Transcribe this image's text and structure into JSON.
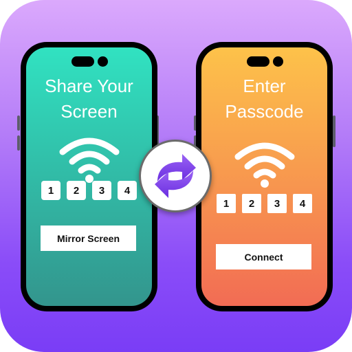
{
  "left_phone": {
    "title_line1": "Share Your",
    "title_line2": "Screen",
    "wifi_icon": "wifi-icon",
    "passcode_digits": [
      "1",
      "2",
      "3",
      "4"
    ],
    "action_label": "Mirror Screen"
  },
  "right_phone": {
    "title_line1": "Enter",
    "title_line2": "Passcode",
    "wifi_icon": "wifi-icon",
    "passcode_digits": [
      "1",
      "2",
      "3",
      "4"
    ],
    "action_label": "Connect"
  },
  "center": {
    "icon": "sync-arrows-icon"
  },
  "colors": {
    "background_top": "#dba9fc",
    "background_bottom": "#7a3df6",
    "left_screen_top": "#31e2c1",
    "left_screen_bottom": "#33958d",
    "right_screen_top": "#fdc24a",
    "right_screen_bottom": "#f26c54",
    "sync_arrow": "#7a3df6"
  }
}
